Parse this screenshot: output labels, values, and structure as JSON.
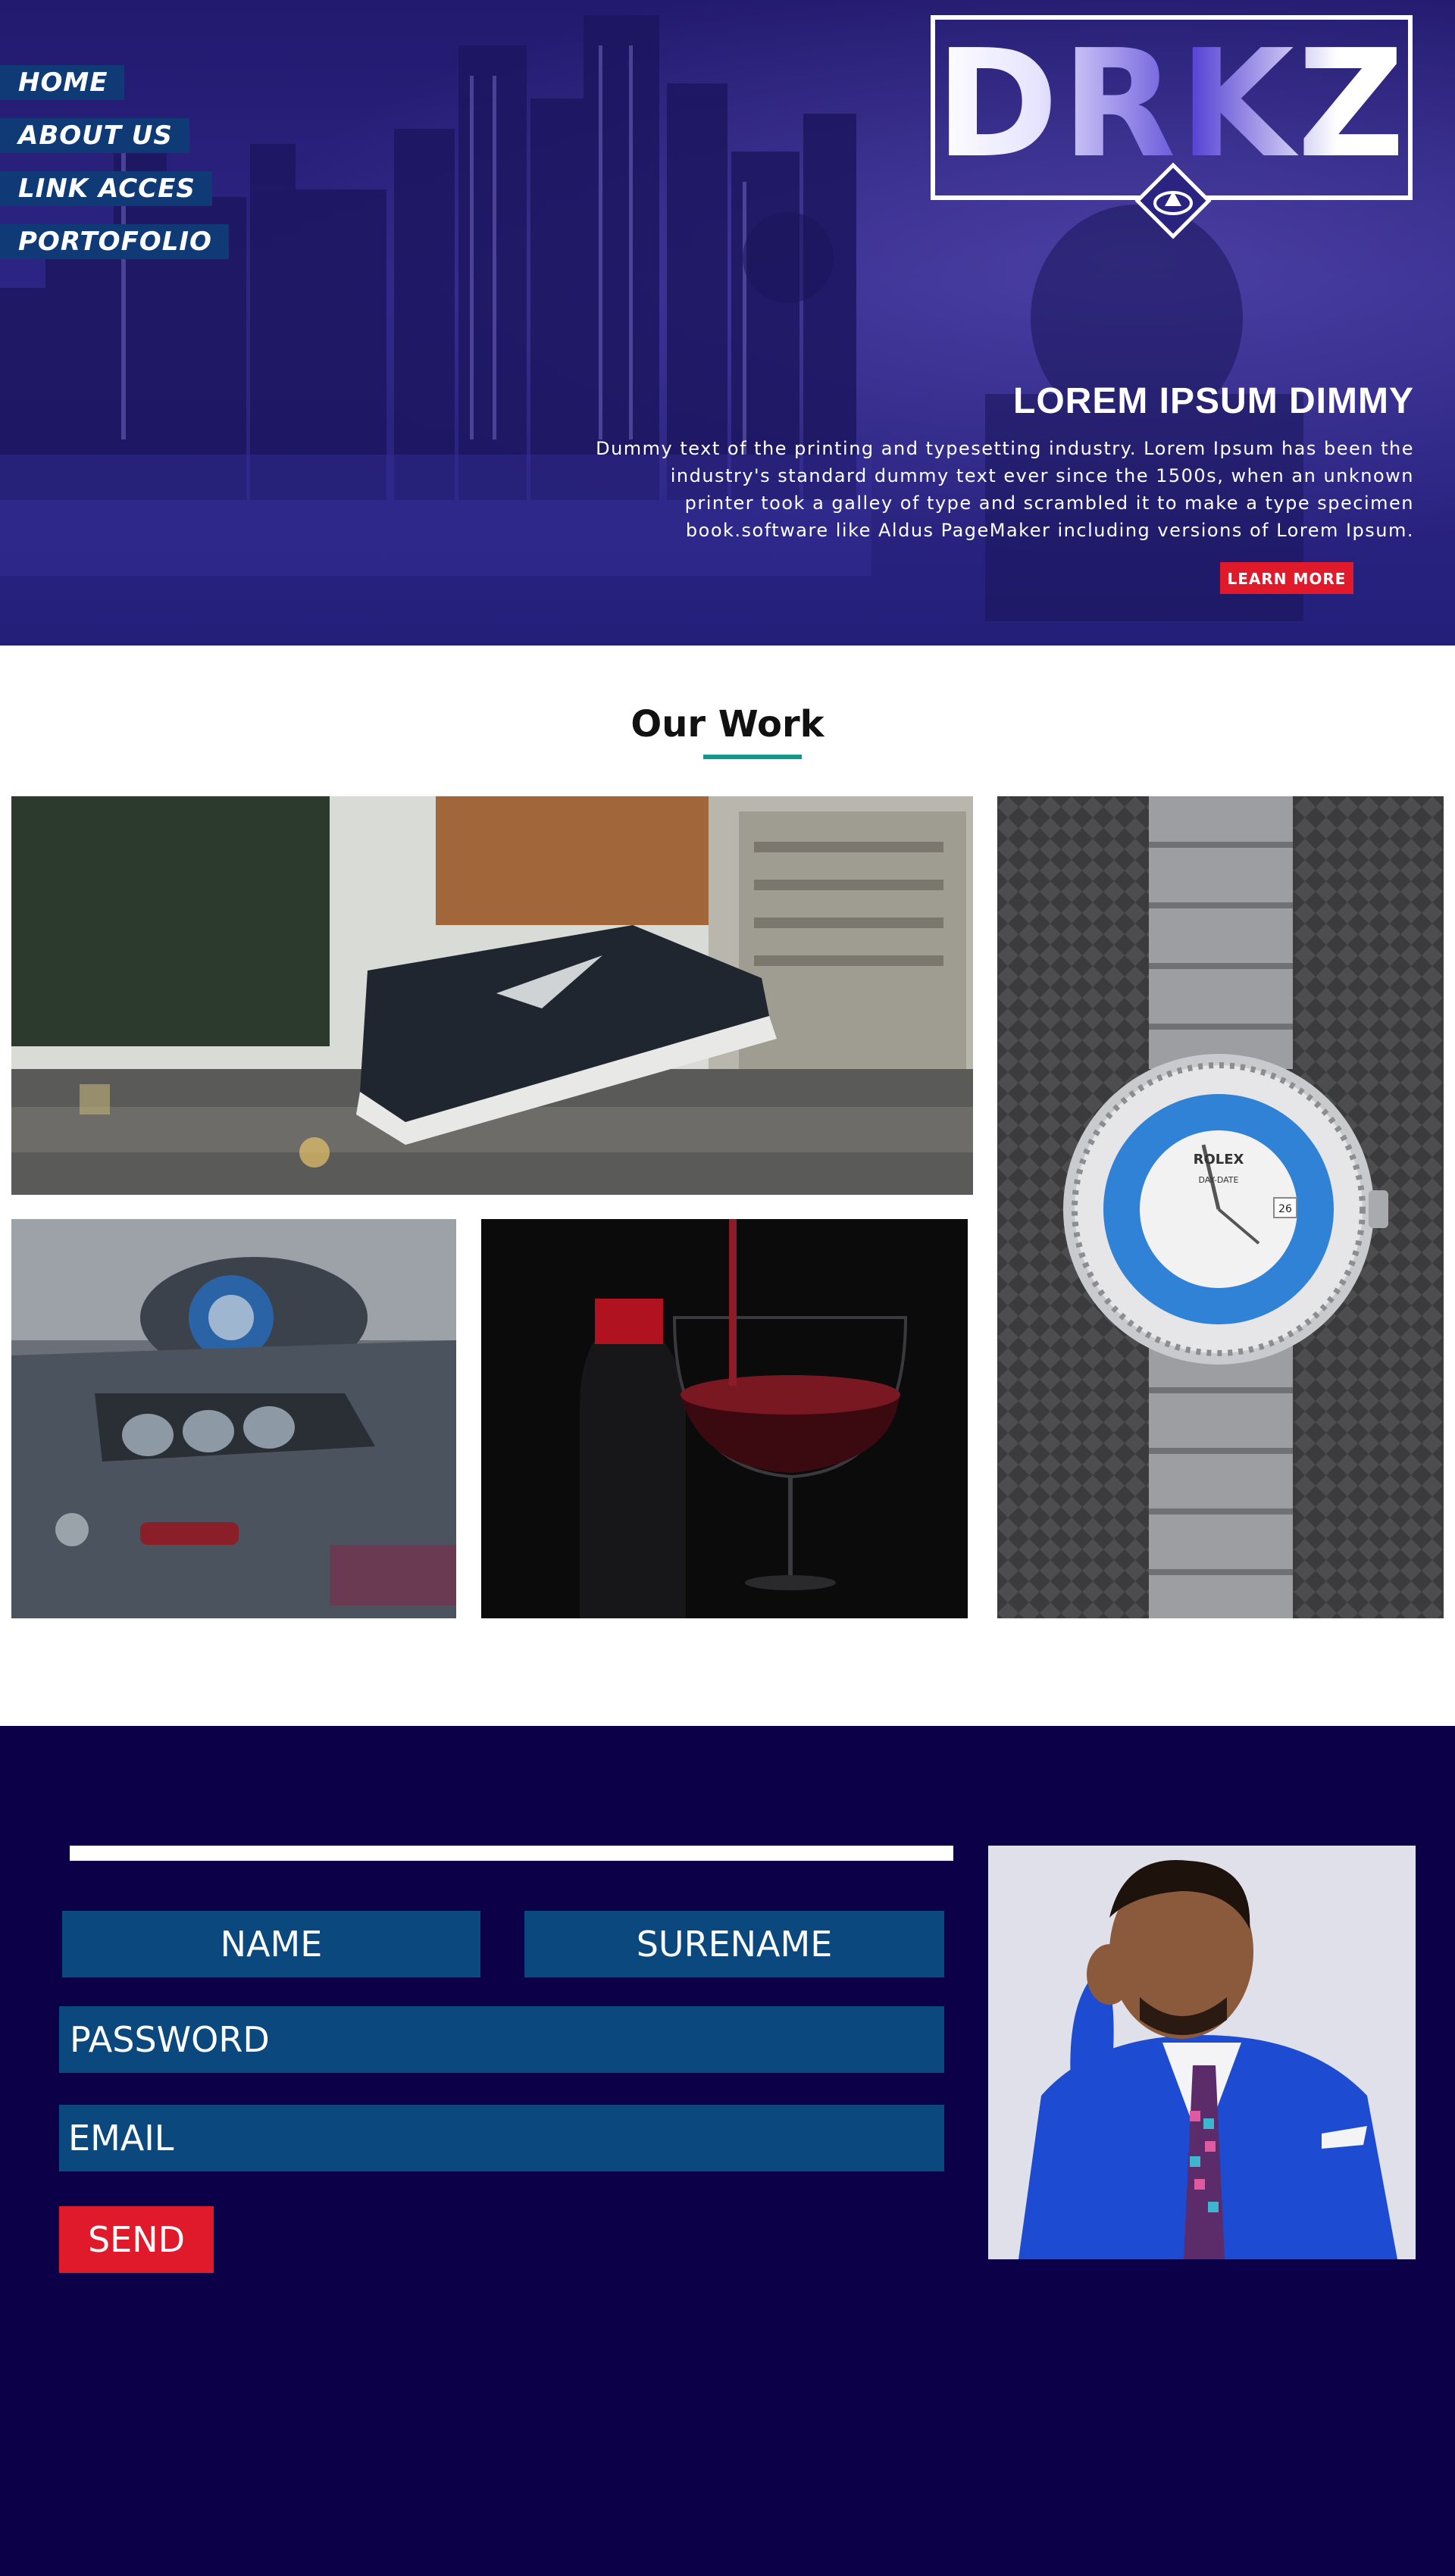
{
  "nav": {
    "items": [
      {
        "label": "HOME"
      },
      {
        "label": "ABOUT US"
      },
      {
        "label": "LINK ACCES"
      },
      {
        "label": "PORTOFOLIO"
      }
    ]
  },
  "brand": {
    "logo_text": "DRKZ"
  },
  "hero": {
    "title": "LOREM IPSUM DIMMY",
    "description": "Dummy text of the printing and typesetting industry. Lorem Ipsum has been the industry's standard dummy text ever since the 1500s, when an unknown printer took a galley of type and scrambled it to make a type specimen book.software like Aldus PageMaker including versions of Lorem Ipsum.",
    "button_label": "LEARN MORE"
  },
  "work": {
    "title": "Our Work",
    "accent_color": "#11988a",
    "tiles": [
      "sneaker-photo",
      "watch-photo",
      "car-photo",
      "wine-photo"
    ],
    "watch_dial": {
      "brand": "ROLEX",
      "model": "DAY-DATE",
      "date": "26"
    }
  },
  "contact": {
    "fields": {
      "name": "NAME",
      "surname": "SURENAME",
      "password": "PASSWORD",
      "email": "EMAIL"
    },
    "send_label": "SEND"
  },
  "colors": {
    "hero_bg": "#2a2380",
    "nav_bg": "#0f3a76",
    "contact_bg": "#0c0049",
    "field_bg": "#0b487e",
    "cta_red": "#e01a2b"
  }
}
